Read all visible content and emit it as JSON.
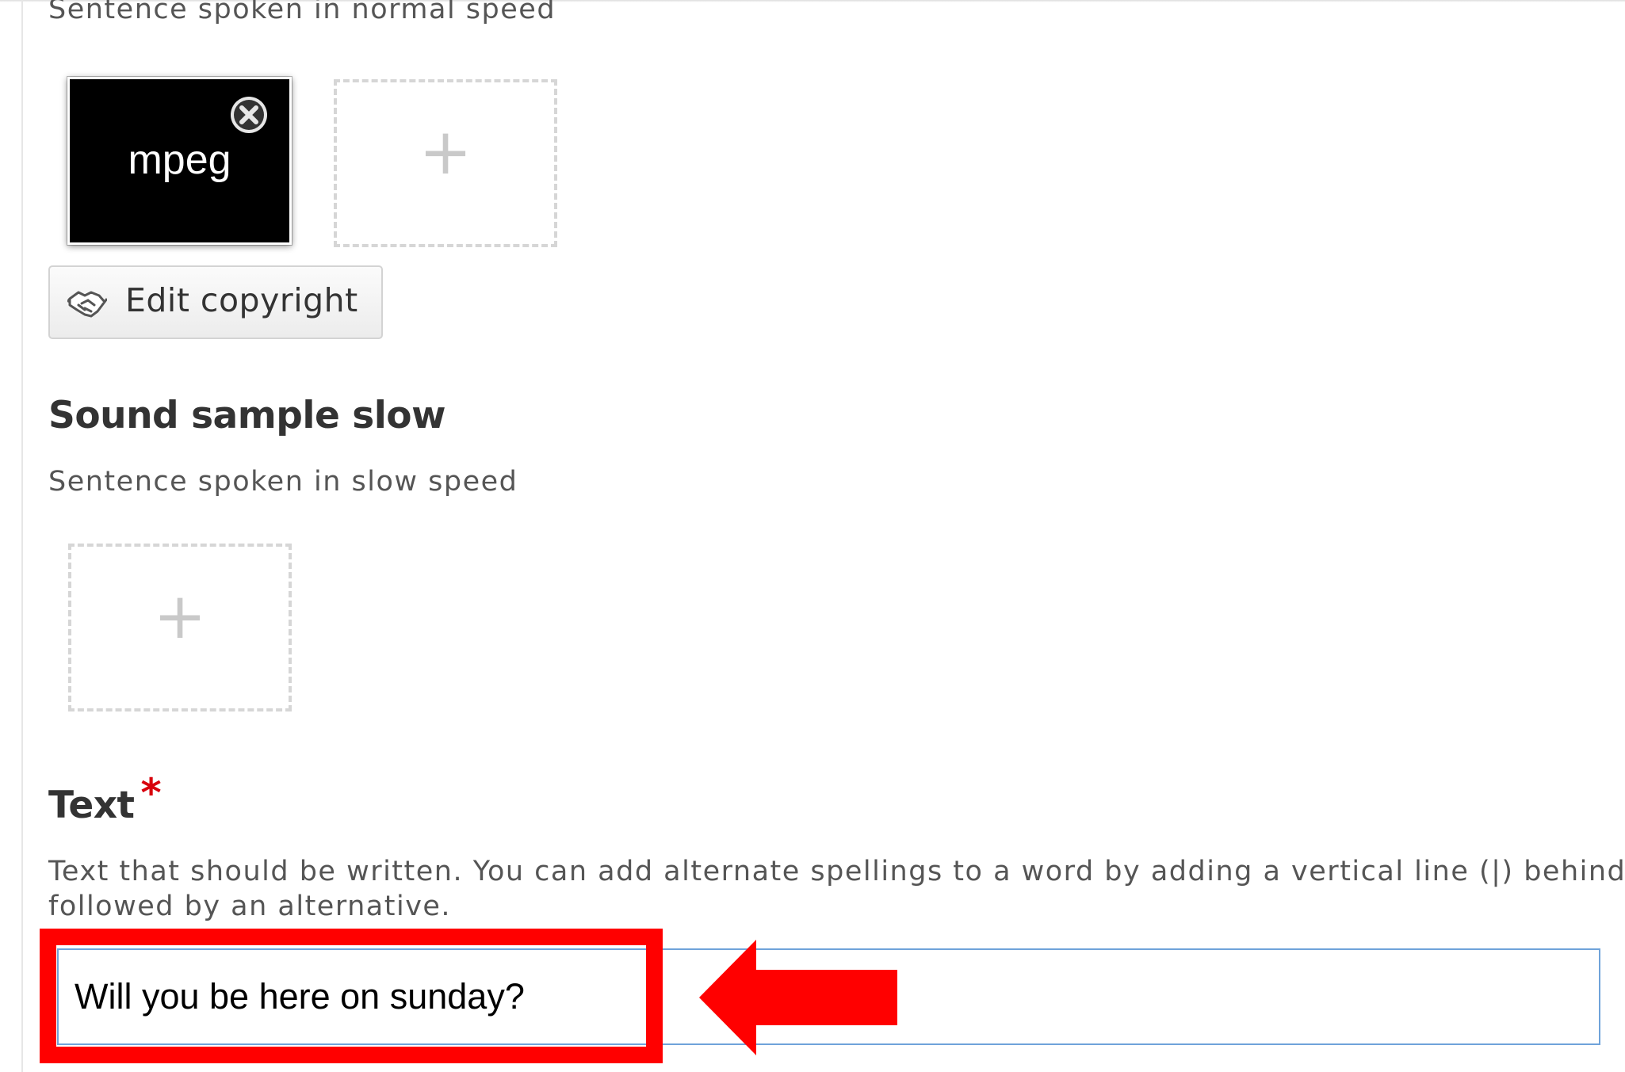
{
  "sound_sample_normal": {
    "description": "Sentence spoken in normal speed",
    "file_type_label": "mpeg",
    "remove_icon": "close-circle-icon",
    "add_slot_symbol": "+",
    "copyright_button_label": "Edit copyright",
    "copyright_icon": "handshake-icon"
  },
  "sound_sample_slow": {
    "title": "Sound sample slow",
    "description": "Sentence spoken in slow speed",
    "add_slot_symbol": "+"
  },
  "text_field": {
    "title": "Text",
    "required_marker": "*",
    "description": "Text that should be written. You can add alternate spellings to a word by adding a vertical line (|) behind followed by an alternative.",
    "description_line1": "Text that should be written. You can add alternate spellings to a word by adding a vertical line (|) behind",
    "description_line2": "followed by an alternative.",
    "value": "Will you be here on sunday?"
  },
  "annotation": {
    "highlight_color": "#ff0000",
    "arrow_icon": "arrow-left-icon"
  },
  "colors": {
    "required": "#d8000c",
    "input_border": "#6fa3da",
    "dashed_border": "#d6d6d6"
  }
}
